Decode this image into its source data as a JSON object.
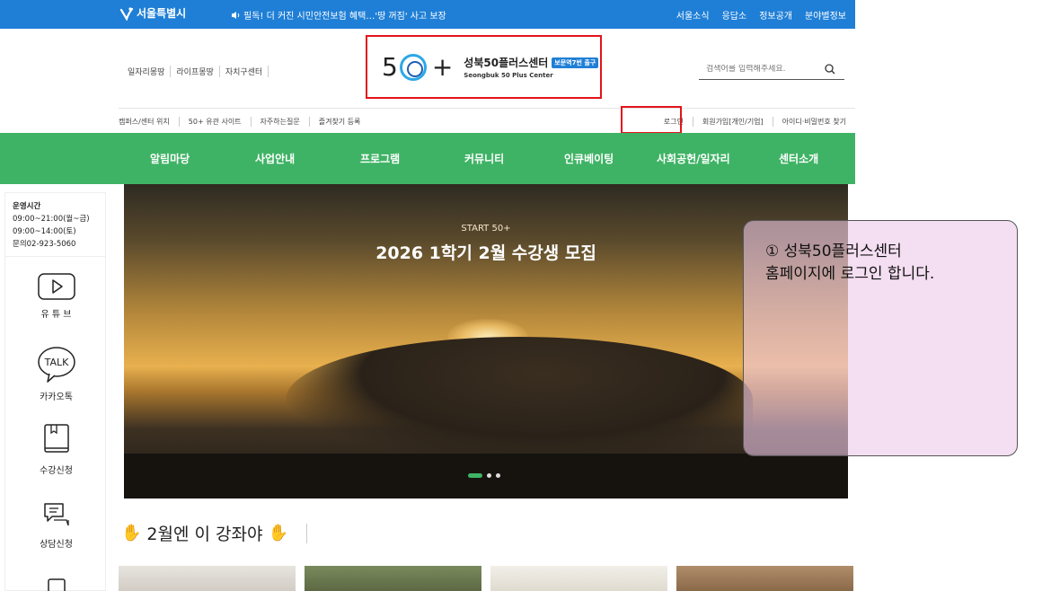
{
  "topbar": {
    "logo": "서울특별시",
    "news": "필독! 더 커진 시민안전보험 혜택…'땅 꺼짐' 사고 보장",
    "links": [
      "서울소식",
      "응답소",
      "정보공개",
      "분야별정보"
    ]
  },
  "header": {
    "util_links": [
      "일자리몽땅",
      "라이프몽땅",
      "자치구센터"
    ],
    "brand": {
      "name_ko": "성북50플러스센터",
      "name_en": "Seongbuk 50 Plus Center",
      "tag": "보문역7번 출구"
    },
    "search_placeholder": "검색어를 입력해주세요."
  },
  "subbar": {
    "left": [
      "캠퍼스/센터 위치",
      "50+ 유관 사이트",
      "자주하는질문",
      "즐겨찾기 등록"
    ],
    "right": [
      "로그인",
      "회원가입[개인/기업]",
      "아이디·비밀번호 찾기"
    ]
  },
  "gnb": [
    "알림마당",
    "사업안내",
    "프로그램",
    "커뮤니티",
    "인큐베이팅",
    "사회공헌/일자리",
    "센터소개"
  ],
  "quick": {
    "hours_title": "운영시간",
    "hours_lines": [
      "09:00~21:00(월~금)",
      "09:00~14:00(토)",
      "문의02-923-5060"
    ],
    "items": [
      {
        "label": "유 튜 브",
        "icon": "youtube-icon"
      },
      {
        "label": "카카오톡",
        "icon": "kakaotalk-icon"
      },
      {
        "label": "수강신청",
        "icon": "book-icon"
      },
      {
        "label": "상담신청",
        "icon": "chat-icon"
      }
    ]
  },
  "banner": {
    "small": "START 50+",
    "big": "2026 1학기 2월 수강생 모집"
  },
  "callout": {
    "line1": "① 성북50플러스센터",
    "line2": "홈페이지에 로그인 합니다."
  },
  "section": {
    "title": "2월엔 이 강좌야"
  },
  "colors": {
    "topbar": "#1f7fd6",
    "gnb": "#3fb365",
    "highlight": "#e3141b",
    "callout": "#ecc8e8"
  }
}
